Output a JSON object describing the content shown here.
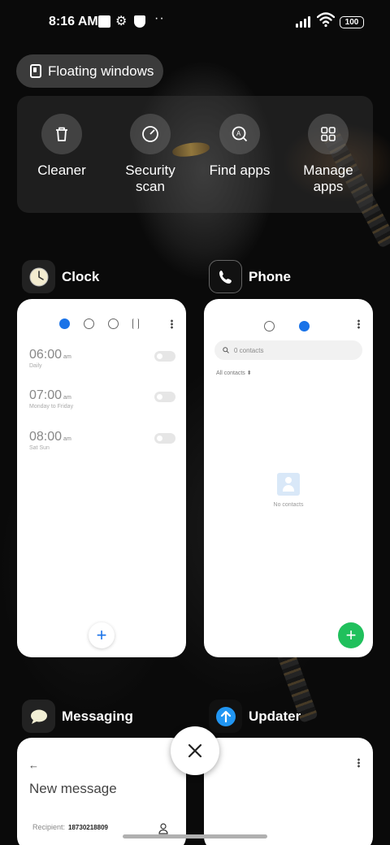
{
  "status_bar": {
    "time": "8:16 AM",
    "battery": "100",
    "icons": [
      "notification-square-icon",
      "gear-icon",
      "shield-icon",
      "more-dots-icon",
      "signal-icon",
      "wifi-icon",
      "battery-icon"
    ]
  },
  "floating_windows": {
    "label": "Floating windows"
  },
  "quick_actions": [
    {
      "label": "Cleaner",
      "icon": "trash-icon"
    },
    {
      "label": "Security scan",
      "icon": "scan-icon"
    },
    {
      "label": "Find apps",
      "icon": "search-app-icon"
    },
    {
      "label": "Manage apps",
      "icon": "grid-icon"
    }
  ],
  "apps": {
    "clock": {
      "name": "Clock",
      "alarms": [
        {
          "time": "06:00",
          "ampm": "am",
          "repeat": "Daily"
        },
        {
          "time": "07:00",
          "ampm": "am",
          "repeat": "Monday to Friday"
        },
        {
          "time": "08:00",
          "ampm": "am",
          "repeat": "Sat Sun"
        }
      ],
      "add": "+"
    },
    "phone": {
      "name": "Phone",
      "search_placeholder": "0 contacts",
      "filter": "All contacts",
      "empty": "No contacts",
      "add": "+"
    },
    "messaging": {
      "name": "Messaging",
      "back": "←",
      "title": "New message",
      "recipient_label": "Recipient:",
      "recipient_value": "18730218809"
    },
    "updater": {
      "name": "Updater"
    }
  },
  "colors": {
    "accent_blue": "#1a73e8",
    "phone_green": "#20c05c",
    "updater_blue": "#2196f3"
  }
}
